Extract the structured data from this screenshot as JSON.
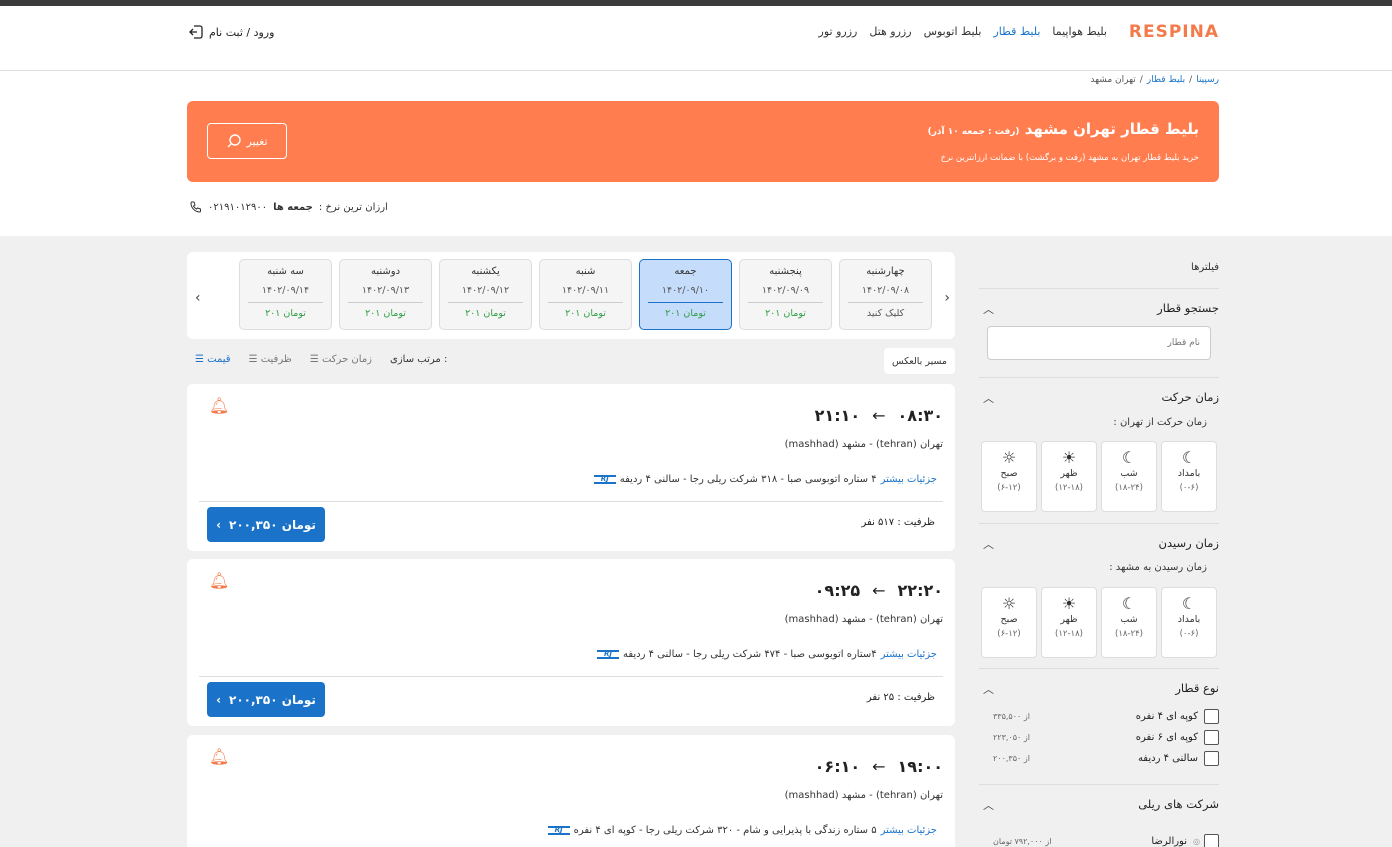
{
  "header": {
    "logo": "RESPINA",
    "nav": [
      "بلیط هواپیما",
      "بلیط قطار",
      "بلیط اتوبوس",
      "رزرو هتل",
      "رزرو تور"
    ],
    "login": "ورود / ثبت نام"
  },
  "breadcrumb": {
    "home": "رسپینا",
    "train": "بلیط قطار",
    "current": "تهران مشهد"
  },
  "hero": {
    "title": "بلیط قطار تهران مشهد",
    "title_note": "(رفت : جمعه ۱۰ آذر)",
    "subtitle": "خرید بلیط قطار تهران به مشهد (رفت و برگشت) با ضمانت ارزانترین نرخ",
    "change": "تغییر"
  },
  "cheapest": {
    "label": "ارزان ترین نرخ :",
    "day": "جمعه ها",
    "phone": "۰۲۱۹۱۰۱۲۹۰۰"
  },
  "filters": {
    "title": "فیلترها",
    "train_search": {
      "title": "جستجو قطار",
      "placeholder": "نام قطار"
    },
    "departure": {
      "title": "زمان حرکت",
      "sub": "زمان حرکت از تهران :",
      "slots": [
        {
          "name": "بامداد",
          "range": "(۰-۶)"
        },
        {
          "name": "شب",
          "range": "(۱۸-۲۴)"
        },
        {
          "name": "ظهر",
          "range": "(۱۲-۱۸)"
        },
        {
          "name": "صبح",
          "range": "(۶-۱۲)"
        }
      ]
    },
    "arrival": {
      "title": "زمان رسیدن",
      "sub": "زمان رسیدن به مشهد :",
      "slots": [
        {
          "name": "بامداد",
          "range": "(۰-۶)"
        },
        {
          "name": "شب",
          "range": "(۱۸-۲۴)"
        },
        {
          "name": "ظهر",
          "range": "(۱۲-۱۸)"
        },
        {
          "name": "صبح",
          "range": "(۶-۱۲)"
        }
      ]
    },
    "train_type": {
      "title": "نوع قطار",
      "items": [
        {
          "label": "کوپه ای ۴ نفره",
          "from": "از ۳۳۵,۵۰۰"
        },
        {
          "label": "کوپه ای ۶ نفره",
          "from": "از ۲۲۳,۰۵۰"
        },
        {
          "label": "سالنی ۴ ردیفه",
          "from": "از ۲۰۰,۳۵۰"
        }
      ]
    },
    "companies": {
      "title": "شرکت های ریلی",
      "items": [
        {
          "label": "نورالرضا",
          "from": "از ۷۹۲,۰۰۰ تومان"
        }
      ]
    }
  },
  "dates": [
    {
      "day": "چهارشنبه",
      "date": "۱۴۰۲/۰۹/۰۸",
      "price": "کلیک کنید"
    },
    {
      "day": "پنجشنبه",
      "date": "۱۴۰۲/۰۹/۰۹",
      "price": "۲۰۱ تومان"
    },
    {
      "day": "جمعه",
      "date": "۱۴۰۲/۰۹/۱۰",
      "price": "۲۰۱ تومان"
    },
    {
      "day": "شنبه",
      "date": "۱۴۰۲/۰۹/۱۱",
      "price": "۲۰۱ تومان"
    },
    {
      "day": "یکشنبه",
      "date": "۱۴۰۲/۰۹/۱۲",
      "price": "۲۰۱ تومان"
    },
    {
      "day": "دوشنبه",
      "date": "۱۴۰۲/۰۹/۱۳",
      "price": "۲۰۱ تومان"
    },
    {
      "day": "سه شنبه",
      "date": "۱۴۰۲/۰۹/۱۴",
      "price": "۲۰۱ تومان"
    }
  ],
  "sort": {
    "reverse": "مسیر بالعکس",
    "label": "مرتب سازی :",
    "options": [
      "زمان حرکت",
      "ظرفیت",
      "قیمت"
    ]
  },
  "trains": [
    {
      "dep": "۰۸:۳۰",
      "arr": "۲۱:۱۰",
      "route": "تهران (tehran) - مشهد (mashhad)",
      "desc": "۴ ستاره اتوبوسی صبا - ۳۱۸ شرکت ریلی رجا - سالنی ۴ ردیفه",
      "more": "جزئیات بیشتر",
      "capacity": "ظرفیت : ۵۱۷ نفر",
      "price": "۲۰۰,۳۵۰ تومان"
    },
    {
      "dep": "۲۲:۲۰",
      "arr": "۰۹:۲۵",
      "route": "تهران (tehran) - مشهد (mashhad)",
      "desc": "۴ستاره اتوبوسی صبا - ۴۷۴ شرکت ریلی رجا - سالنی ۴ ردیفه",
      "more": "جزئیات بیشتر",
      "capacity": "ظرفیت : ۲۵ نفر",
      "price": "۲۰۰,۳۵۰ تومان"
    },
    {
      "dep": "۱۹:۰۰",
      "arr": "۰۶:۱۰",
      "route": "تهران (tehran) - مشهد (mashhad)",
      "desc": "۵ ستاره زندگی با پذیرایی و شام - ۳۲۰ شرکت ریلی رجا - کوپه ای ۴ نفره",
      "more": "جزئیات بیشتر"
    }
  ]
}
